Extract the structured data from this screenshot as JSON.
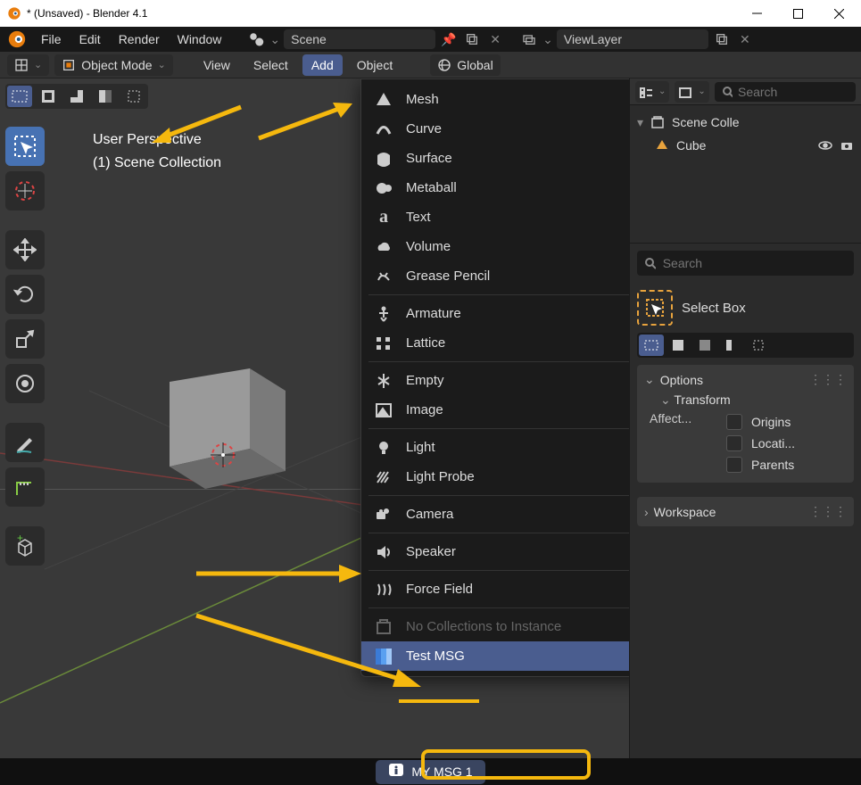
{
  "window": {
    "title": "* (Unsaved) - Blender 4.1"
  },
  "topmenu": {
    "file": "File",
    "edit": "Edit",
    "render": "Render",
    "window": "Window"
  },
  "scene": {
    "name": "Scene",
    "layer": "ViewLayer"
  },
  "header": {
    "mode": "Object Mode",
    "view": "View",
    "select": "Select",
    "add": "Add",
    "object": "Object",
    "orientation": "Global"
  },
  "viewport": {
    "perspective": "User Perspective",
    "collection": "(1) Scene Collection"
  },
  "addmenu": {
    "mesh": "Mesh",
    "curve": "Curve",
    "surface": "Surface",
    "metaball": "Metaball",
    "text": "Text",
    "volume": "Volume",
    "grease": "Grease Pencil",
    "armature": "Armature",
    "lattice": "Lattice",
    "empty": "Empty",
    "image": "Image",
    "light": "Light",
    "lightprobe": "Light Probe",
    "camera": "Camera",
    "speaker": "Speaker",
    "forcefield": "Force Field",
    "nocoll": "No Collections to Instance",
    "testmsg": "Test MSG"
  },
  "outliner": {
    "scene_coll": "Scene Colle",
    "cube": "Cube",
    "search_placeholder": "Search"
  },
  "rightpanel": {
    "search_placeholder": "Search",
    "selectbox": "Select Box",
    "options": "Options",
    "transform": "Transform",
    "affect": "Affect...",
    "origins": "Origins",
    "locations": "Locati...",
    "parents": "Parents",
    "workspace": "Workspace"
  },
  "status": {
    "msg": "MY MSG 1"
  }
}
